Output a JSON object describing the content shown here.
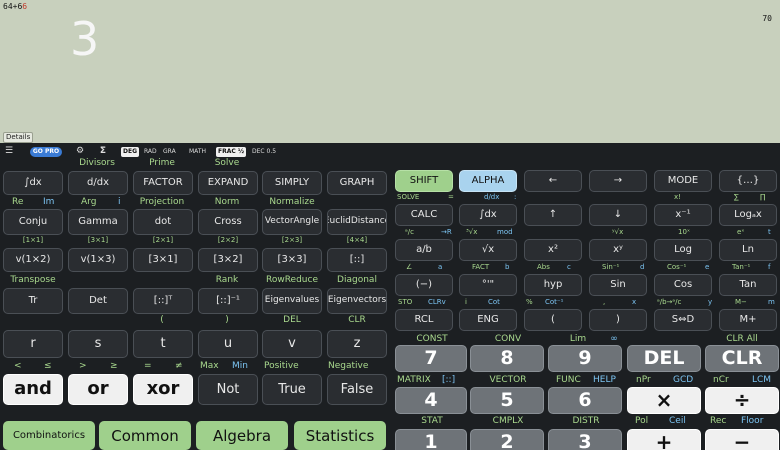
{
  "display": {
    "expression": "64+6",
    "result_big": "3",
    "result_small": "70",
    "details_button": "Details"
  },
  "status_bar": {
    "menu_icon": "☰",
    "go_pro": "GO PRO",
    "gear_icon": "⚙",
    "sigma_icon": "Σ",
    "modes": [
      "DEG",
      "RAD",
      "GRA",
      "MATH",
      "FRAC ½",
      "DEC 0.5"
    ],
    "selected_modes": [
      "DEG",
      "FRAC ½"
    ]
  },
  "left_pad": {
    "row1_labels": [
      "Divisors",
      "Prime",
      "Solve"
    ],
    "row1": [
      "∫dx",
      "d/dx",
      "FACTOR",
      "EXPAND",
      "SIMPLY",
      "GRAPH"
    ],
    "row2_labels": [
      "Re",
      "Im",
      "Arg",
      "i",
      "Projection",
      "Norm",
      "Normalize"
    ],
    "row2": [
      "Conju",
      "Gamma",
      "dot",
      "Cross",
      "VectorAngle",
      "EuclidDistance"
    ],
    "row3_labels": [
      "[1×1]",
      "[3×1]",
      "[2×1]",
      "[2×2]",
      "[2×3]",
      "[4×4]"
    ],
    "row3": [
      "v(1×2)",
      "v(1×3)",
      "[3×1]",
      "[3×2]",
      "[3×3]",
      "[::]"
    ],
    "row4_labels": [
      "Transpose",
      "Rank",
      "RowReduce",
      "Diagonal"
    ],
    "row4": [
      "Tr",
      "Det",
      "[::]ᵀ",
      "[::]⁻¹",
      "Eigenvalues",
      "Eigenvectors"
    ],
    "row5_labels": [
      "(",
      ")",
      "DEL",
      "CLR"
    ],
    "row5": [
      "r",
      "s",
      "t",
      "u",
      "v",
      "z"
    ],
    "row6_labels": [
      "<",
      "≤",
      ">",
      "≥",
      "=",
      "≠",
      "Max",
      "Min",
      "Positive",
      "Negative"
    ],
    "row6": [
      "and",
      "or",
      "xor",
      "Not",
      "True",
      "False"
    ],
    "tabs": [
      "Combinatorics",
      "Common",
      "Algebra",
      "Statistics"
    ]
  },
  "right_pad": {
    "row1": [
      "SHIFT",
      "ALPHA",
      "←",
      "→",
      "MODE",
      "{…}"
    ],
    "row2_labels": [
      "SOLVE",
      "=",
      "d/dx",
      ":",
      "x!",
      "∑",
      "∏"
    ],
    "row2": [
      "CALC",
      "∫dx",
      "↑",
      "↓",
      "x⁻¹",
      "Logₐx"
    ],
    "row3_labels": [
      "ᵃ/c",
      "→R",
      "³√x",
      "mod",
      "ʸ√x",
      "10ˣ",
      "eˣ",
      "t"
    ],
    "row3": [
      "a/b",
      "√x",
      "x²",
      "xʸ",
      "Log",
      "Ln"
    ],
    "row4_labels": [
      "∠",
      "a",
      "FACT",
      "b",
      "Abs",
      "c",
      "Sin⁻¹",
      "d",
      "Cos⁻¹",
      "e",
      "Tan⁻¹",
      "f"
    ],
    "row4": [
      "(−)",
      "°'\"",
      "hyp",
      "Sin",
      "Cos",
      "Tan"
    ],
    "row5_labels": [
      "STO",
      "CLRv",
      "i",
      "Cot",
      "%",
      "Cot⁻¹",
      ",",
      "x",
      "ᵃ/b→ᵃ/c",
      "y",
      "M−",
      "m"
    ],
    "row5": [
      "RCL",
      "ENG",
      "(",
      ")",
      "S⇔D",
      "M+"
    ],
    "row6_labels": [
      "CONST",
      "CONV",
      "Lim",
      "∞",
      "CLR All"
    ],
    "row6": [
      "7",
      "8",
      "9",
      "DEL",
      "CLR"
    ],
    "row7_labels": [
      "MATRIX",
      "[::]",
      "VECTOR",
      "FUNC",
      "HELP",
      "nPr",
      "GCD",
      "nCr",
      "LCM"
    ],
    "row7": [
      "4",
      "5",
      "6",
      "×",
      "÷"
    ],
    "row8_labels": [
      "STAT",
      "CMPLX",
      "DISTR",
      "Pol",
      "Ceil",
      "Rec",
      "Floor"
    ],
    "row8": [
      "1",
      "2",
      "3",
      "+",
      "−"
    ]
  },
  "colors": {
    "display_bg": "#c8d0bd",
    "pad_bg": "#1c1f22",
    "label_green": "#a9d98e",
    "label_blue": "#7cc4f2",
    "shift_key": "#9fd08c",
    "alpha_key": "#a9d3ee",
    "go_pro": "#3a7bd5"
  }
}
